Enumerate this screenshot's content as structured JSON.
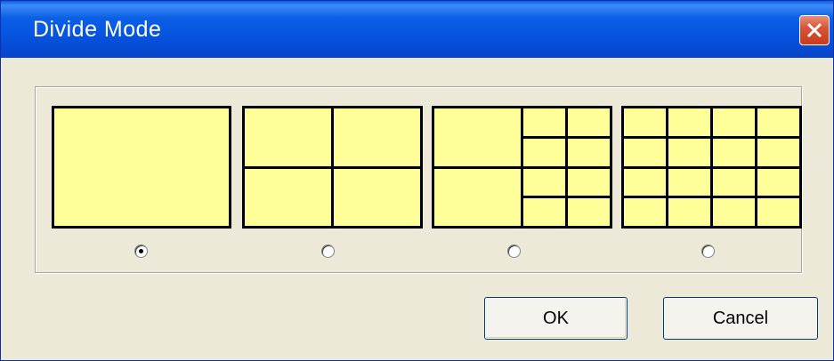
{
  "window": {
    "title": "Divide Mode",
    "close_icon": "close-icon"
  },
  "modes": [
    {
      "name": "single",
      "cols": 1,
      "rows": 1,
      "selected": true
    },
    {
      "name": "quad",
      "cols": 2,
      "rows": 2,
      "selected": false
    },
    {
      "name": "ten-split",
      "cols": 4,
      "rows": 4,
      "selected": false
    },
    {
      "name": "sixteen",
      "cols": 4,
      "rows": 4,
      "selected": false
    }
  ],
  "buttons": {
    "ok_label": "OK",
    "cancel_label": "Cancel"
  },
  "colors": {
    "cell_fill": "#FFFF99",
    "title_bar": "#0654E0",
    "close_button": "#D8553A",
    "dialog_bg": "#ECE9D8"
  }
}
